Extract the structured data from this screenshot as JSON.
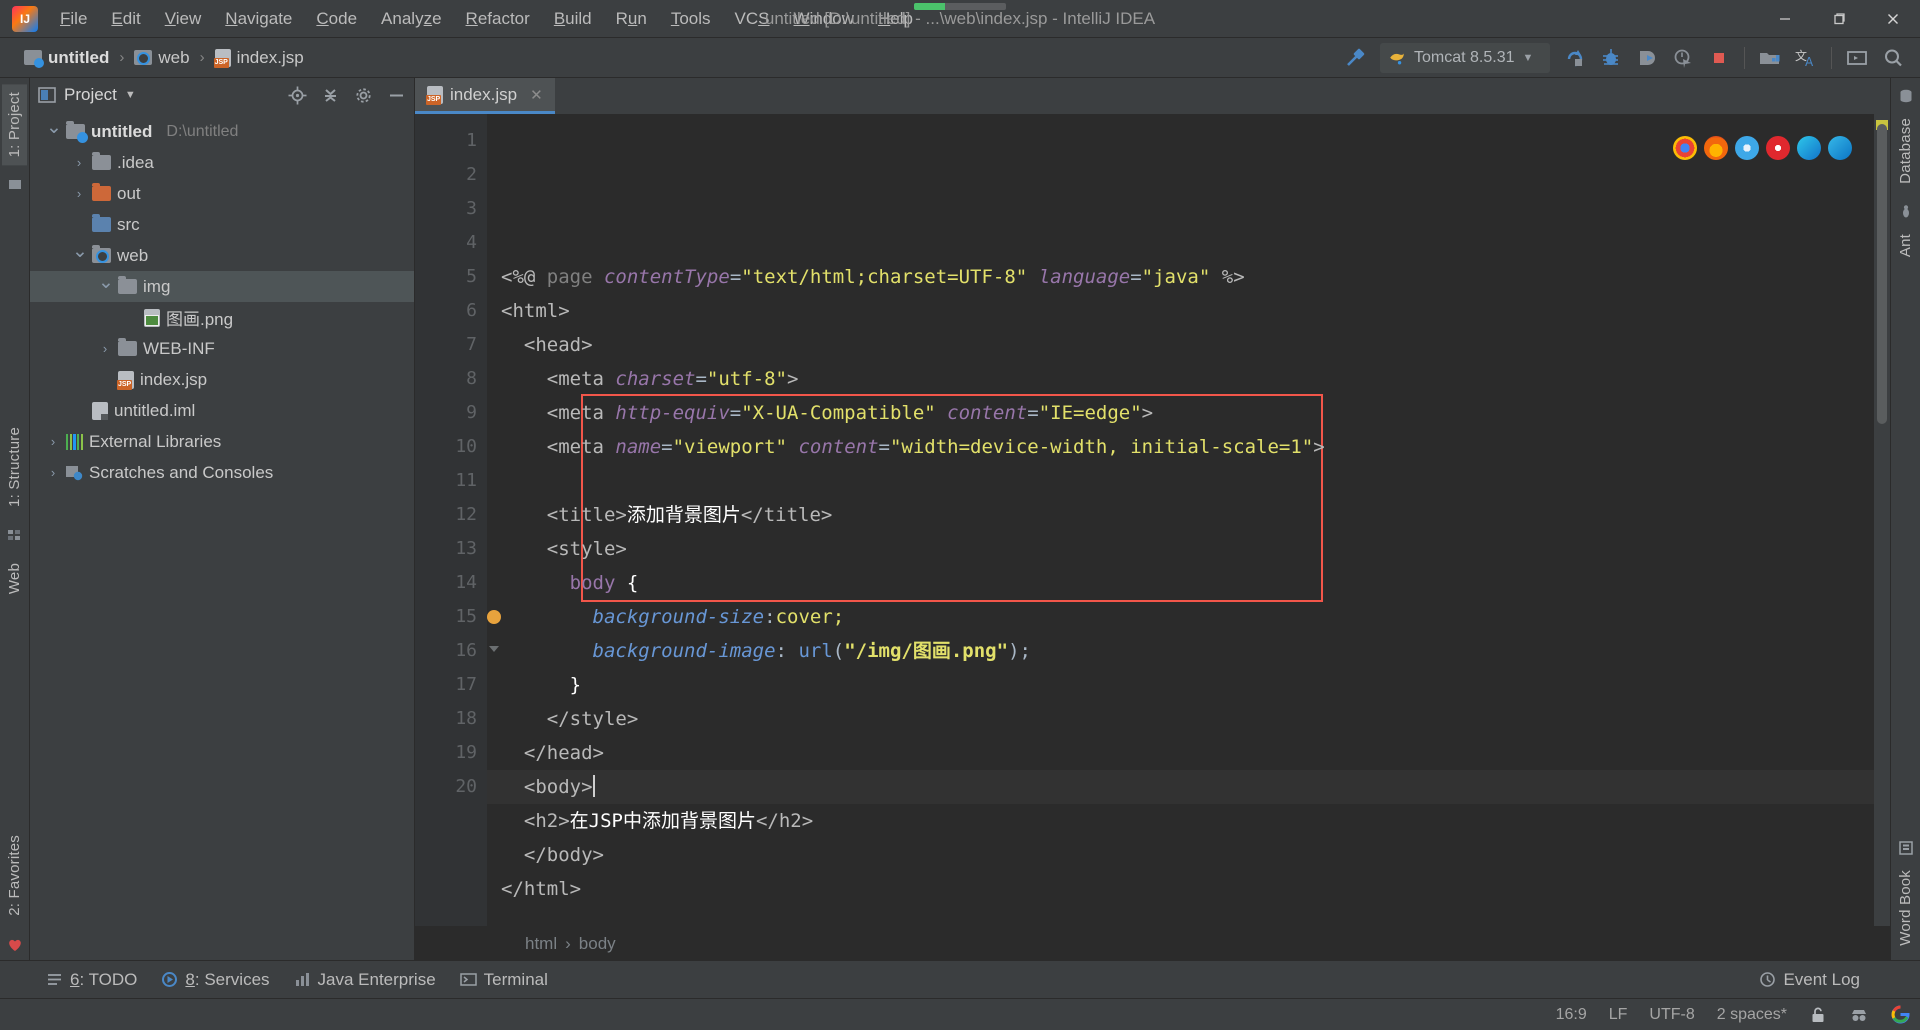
{
  "window": {
    "title": "untitled [D:\\untitled] - ...\\web\\index.jsp - IntelliJ IDEA",
    "minimize": "—",
    "maximize": "❐",
    "close": "✕",
    "progress_percent": 34,
    "progress_color": "#4bc26b"
  },
  "menubar": {
    "items": [
      {
        "label": "File",
        "mnemonic": "F"
      },
      {
        "label": "Edit",
        "mnemonic": "E"
      },
      {
        "label": "View",
        "mnemonic": "V"
      },
      {
        "label": "Navigate",
        "mnemonic": "N"
      },
      {
        "label": "Code",
        "mnemonic": "C"
      },
      {
        "label": "Analyze",
        "mnemonic": "z"
      },
      {
        "label": "Refactor",
        "mnemonic": "R"
      },
      {
        "label": "Build",
        "mnemonic": "B"
      },
      {
        "label": "Run",
        "mnemonic": "u"
      },
      {
        "label": "Tools",
        "mnemonic": "T"
      },
      {
        "label": "VCS",
        "mnemonic": "S"
      },
      {
        "label": "Window",
        "mnemonic": "W"
      },
      {
        "label": "Help",
        "mnemonic": "H"
      }
    ]
  },
  "breadcrumb": {
    "items": [
      "untitled",
      "web",
      "index.jsp"
    ],
    "separator": "›"
  },
  "toolbar": {
    "build_label": "build-hammer-icon",
    "run_config": "Tomcat 8.5.31",
    "dropdown_caret": "▼",
    "buttons": [
      "rerun-icon",
      "debug-icon",
      "run-with-coverage-icon",
      "profile-icon",
      "stop-icon",
      "project-structure-icon",
      "translate-icon",
      "terminal-icon",
      "search-everywhere-icon"
    ]
  },
  "left_strip": {
    "top": [
      "1: Project"
    ],
    "bottom": [
      "1: Structure",
      "2: Favorites"
    ],
    "middle": [
      "Web"
    ]
  },
  "right_strip": {
    "top": [
      "Database",
      "Ant"
    ],
    "bottom": [
      "Word Book"
    ]
  },
  "project_panel": {
    "title": "Project",
    "caret": "▼",
    "locate_icon": "locate-icon",
    "collapse_icon": "collapse-all-icon",
    "settings_icon": "gear-icon",
    "hide_icon": "hide-icon",
    "tree": [
      {
        "label": "untitled",
        "sub": "D:\\untitled",
        "depth": 0,
        "arrow": "open",
        "icon": "module-folder",
        "bold": true,
        "selected": false
      },
      {
        "label": ".idea",
        "sub": "",
        "depth": 1,
        "arrow": "closed",
        "icon": "folder-gray",
        "bold": false,
        "selected": false
      },
      {
        "label": "out",
        "sub": "",
        "depth": 1,
        "arrow": "closed",
        "icon": "folder-orange",
        "bold": false,
        "selected": false
      },
      {
        "label": "src",
        "sub": "",
        "depth": 1,
        "arrow": "none",
        "icon": "folder-src",
        "bold": false,
        "selected": false
      },
      {
        "label": "web",
        "sub": "",
        "depth": 1,
        "arrow": "open",
        "icon": "folder-webroot",
        "bold": false,
        "selected": false
      },
      {
        "label": "img",
        "sub": "",
        "depth": 2,
        "arrow": "open",
        "icon": "folder-gray",
        "bold": false,
        "selected": true
      },
      {
        "label": "图画.png",
        "sub": "",
        "depth": 3,
        "arrow": "none",
        "icon": "png-file",
        "bold": false,
        "selected": false
      },
      {
        "label": "WEB-INF",
        "sub": "",
        "depth": 2,
        "arrow": "closed",
        "icon": "folder-gray",
        "bold": false,
        "selected": false
      },
      {
        "label": "index.jsp",
        "sub": "",
        "depth": 2,
        "arrow": "none",
        "icon": "jsp-file",
        "bold": false,
        "selected": false
      },
      {
        "label": "untitled.iml",
        "sub": "",
        "depth": 1,
        "arrow": "none",
        "icon": "iml-file",
        "bold": false,
        "selected": false
      },
      {
        "label": "External Libraries",
        "sub": "",
        "depth": 0,
        "arrow": "closed",
        "icon": "library",
        "bold": false,
        "selected": false
      },
      {
        "label": "Scratches and Consoles",
        "sub": "",
        "depth": 0,
        "arrow": "closed",
        "icon": "scratch",
        "bold": false,
        "selected": false
      }
    ]
  },
  "editor": {
    "tab": {
      "label": "index.jsp",
      "close": "✕",
      "icon": "jsp-file-icon"
    },
    "line_count": 20,
    "current_line": 16,
    "breakpoint_line": 15,
    "breadcrumbs": [
      "html",
      "body"
    ],
    "breadcrumb_sep": "›",
    "highlight_box": {
      "from_line": 9,
      "to_line": 14,
      "color": "#f2564a"
    },
    "browser_icons": [
      "chrome-icon",
      "firefox-icon",
      "safari-icon",
      "opera-icon",
      "edge-icon",
      "ie-icon"
    ],
    "lines": [
      {
        "n": 1,
        "segs": [
          {
            "t": "<%@ ",
            "c": "t-tagn"
          },
          {
            "t": "page ",
            "c": "t-gray"
          },
          {
            "t": "contentType",
            "c": "t-attr"
          },
          {
            "t": "=",
            "c": "t-plain"
          },
          {
            "t": "\"text/html;charset=UTF-8\"",
            "c": "t-val"
          },
          {
            "t": " ",
            "c": "t-plain"
          },
          {
            "t": "language",
            "c": "t-attr"
          },
          {
            "t": "=",
            "c": "t-plain"
          },
          {
            "t": "\"java\"",
            "c": "t-val"
          },
          {
            "t": " %>",
            "c": "t-tagn"
          }
        ]
      },
      {
        "n": 2,
        "segs": [
          {
            "t": "<html>",
            "c": "t-tagn"
          }
        ]
      },
      {
        "n": 3,
        "segs": [
          {
            "t": "  <head>",
            "c": "t-tagn"
          }
        ]
      },
      {
        "n": 4,
        "segs": [
          {
            "t": "    <meta ",
            "c": "t-tagn"
          },
          {
            "t": "charset",
            "c": "t-attr"
          },
          {
            "t": "=",
            "c": "t-plain"
          },
          {
            "t": "\"utf-8\"",
            "c": "t-val"
          },
          {
            "t": ">",
            "c": "t-tagn"
          }
        ]
      },
      {
        "n": 5,
        "segs": [
          {
            "t": "    <meta ",
            "c": "t-tagn"
          },
          {
            "t": "http-equiv",
            "c": "t-attr"
          },
          {
            "t": "=",
            "c": "t-plain"
          },
          {
            "t": "\"X-UA-Compatible\"",
            "c": "t-val"
          },
          {
            "t": " ",
            "c": "t-plain"
          },
          {
            "t": "content",
            "c": "t-attr"
          },
          {
            "t": "=",
            "c": "t-plain"
          },
          {
            "t": "\"IE=edge\"",
            "c": "t-val"
          },
          {
            "t": ">",
            "c": "t-tagn"
          }
        ]
      },
      {
        "n": 6,
        "segs": [
          {
            "t": "    <meta ",
            "c": "t-tagn"
          },
          {
            "t": "name",
            "c": "t-attr"
          },
          {
            "t": "=",
            "c": "t-plain"
          },
          {
            "t": "\"viewport\"",
            "c": "t-val"
          },
          {
            "t": " ",
            "c": "t-plain"
          },
          {
            "t": "content",
            "c": "t-attr"
          },
          {
            "t": "=",
            "c": "t-plain"
          },
          {
            "t": "\"width=device-width, initial-scale=1\"",
            "c": "t-val"
          },
          {
            "t": ">",
            "c": "t-tagn"
          }
        ]
      },
      {
        "n": 7,
        "segs": []
      },
      {
        "n": 8,
        "segs": [
          {
            "t": "    <title>",
            "c": "t-tagn"
          },
          {
            "t": "添加背景图片",
            "c": "t-text"
          },
          {
            "t": "</title>",
            "c": "t-tagn"
          }
        ]
      },
      {
        "n": 9,
        "segs": [
          {
            "t": "    <style>",
            "c": "t-tagn"
          }
        ]
      },
      {
        "n": 10,
        "segs": [
          {
            "t": "      ",
            "c": "t-plain"
          },
          {
            "t": "body",
            "c": "t-sel"
          },
          {
            "t": " {",
            "c": "t-brace"
          }
        ]
      },
      {
        "n": 11,
        "segs": [
          {
            "t": "        ",
            "c": "t-plain"
          },
          {
            "t": "background-size",
            "c": "t-prop"
          },
          {
            "t": ":",
            "c": "t-plain"
          },
          {
            "t": "cover;",
            "c": "t-cssval"
          }
        ]
      },
      {
        "n": 12,
        "segs": [
          {
            "t": "        ",
            "c": "t-plain"
          },
          {
            "t": "background-image",
            "c": "t-prop"
          },
          {
            "t": ": ",
            "c": "t-plain"
          },
          {
            "t": "url",
            "c": "t-fn"
          },
          {
            "t": "(",
            "c": "t-plain"
          },
          {
            "t": "\"/img/图画.png\"",
            "c": "t-str"
          },
          {
            "t": ");",
            "c": "t-plain"
          }
        ]
      },
      {
        "n": 13,
        "segs": [
          {
            "t": "      }",
            "c": "t-brace"
          }
        ]
      },
      {
        "n": 14,
        "segs": [
          {
            "t": "    </style>",
            "c": "t-tagn"
          }
        ]
      },
      {
        "n": 15,
        "segs": [
          {
            "t": "  </head>",
            "c": "t-tagn"
          }
        ]
      },
      {
        "n": 16,
        "segs": [
          {
            "t": "  <body>",
            "c": "t-tagn"
          }
        ]
      },
      {
        "n": 17,
        "segs": [
          {
            "t": "  <h2>",
            "c": "t-tagn"
          },
          {
            "t": "在JSP中添加背景图片",
            "c": "t-text"
          },
          {
            "t": "</h2>",
            "c": "t-tagn"
          }
        ]
      },
      {
        "n": 18,
        "segs": [
          {
            "t": "  </body>",
            "c": "t-tagn"
          }
        ]
      },
      {
        "n": 19,
        "segs": [
          {
            "t": "</html>",
            "c": "t-tagn"
          }
        ]
      },
      {
        "n": 20,
        "segs": []
      }
    ]
  },
  "bottom_bar": {
    "windows": [
      {
        "label": "6: TODO",
        "mnemonic": "6",
        "icon": "todo-icon"
      },
      {
        "label": "8: Services",
        "mnemonic": "8",
        "icon": "services-icon"
      },
      {
        "label": "Java Enterprise",
        "mnemonic": "",
        "icon": "java-enterprise-icon"
      },
      {
        "label": "Terminal",
        "mnemonic": "",
        "icon": "terminal-icon"
      }
    ],
    "event_log": "Event Log",
    "event_log_icon": "event-log-icon"
  },
  "statusbar": {
    "caret_position": "16:9",
    "line_separator": "LF",
    "encoding": "UTF-8",
    "indent": "2 spaces*",
    "lock_icon": "unlocked-padlock-icon",
    "user_icon": "incognito-icon",
    "google_icon": "google-icon"
  },
  "colors": {
    "accent": "#4a88c7",
    "selection": "#4e5557",
    "editor_bg": "#2b2b2b",
    "panel_bg": "#3c3f41",
    "highlight_red": "#f2564a"
  }
}
